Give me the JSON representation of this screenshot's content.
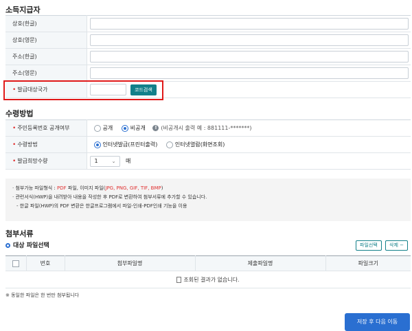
{
  "income_payer": {
    "title": "소득지급자",
    "fields": [
      {
        "label": "상호(한글)",
        "value": ""
      },
      {
        "label": "상호(영문)",
        "value": ""
      },
      {
        "label": "주소(한글)",
        "value": ""
      },
      {
        "label": "주소(영문)",
        "value": ""
      }
    ],
    "country": {
      "label": "발급대상국가",
      "value": "",
      "search_button": "코드검색"
    }
  },
  "receipt": {
    "title": "수령방법",
    "rrn_public": {
      "label": "주민등록번호 공개여부",
      "options": [
        "공개",
        "비공개"
      ],
      "selected": "비공개",
      "hint": "(비공개시 출력 예 : 881111-*******)"
    },
    "method": {
      "label": "수령방법",
      "options": [
        "인터넷발급(프린터출력)",
        "인터넷열람(화면조회)"
      ],
      "selected": "인터넷발급(프린터출력)"
    },
    "quantity": {
      "label": "발급희망수량",
      "value": "1",
      "unit": "매"
    }
  },
  "notice": {
    "line1_prefix": "· 첨부가능 파일형식 : ",
    "line1_pdf": "PDF",
    "line1_mid": " 파일, 이미지 파일(",
    "line1_img": "JPG, PNG, GIF, TIF, BMP",
    "line1_suffix": ")",
    "line2": "· 관련서식(HWP)을 내려받아 내용을 작성한 후 PDF로 변환하여 첨부서류에 추가할 수 있습니다.",
    "line3": "- 한글 파일(HWP)의 PDF 변환은 한글프로그램에서 파일-인쇄-PDF인쇄 기능을 이용"
  },
  "attachments": {
    "title": "첨부서류",
    "subtitle": "대상 파일선택",
    "select_button": "파일선택",
    "delete_button": "삭제",
    "delete_symbol": "−",
    "columns": [
      "번호",
      "첨부파일명",
      "제출파일명",
      "파일크기"
    ],
    "empty_message": "조회된 결과가 없습니다.",
    "footnote": "※ 동일한 파일은 한 번만 첨부됩니다"
  },
  "submit_button": "저장 후 다음 이동"
}
